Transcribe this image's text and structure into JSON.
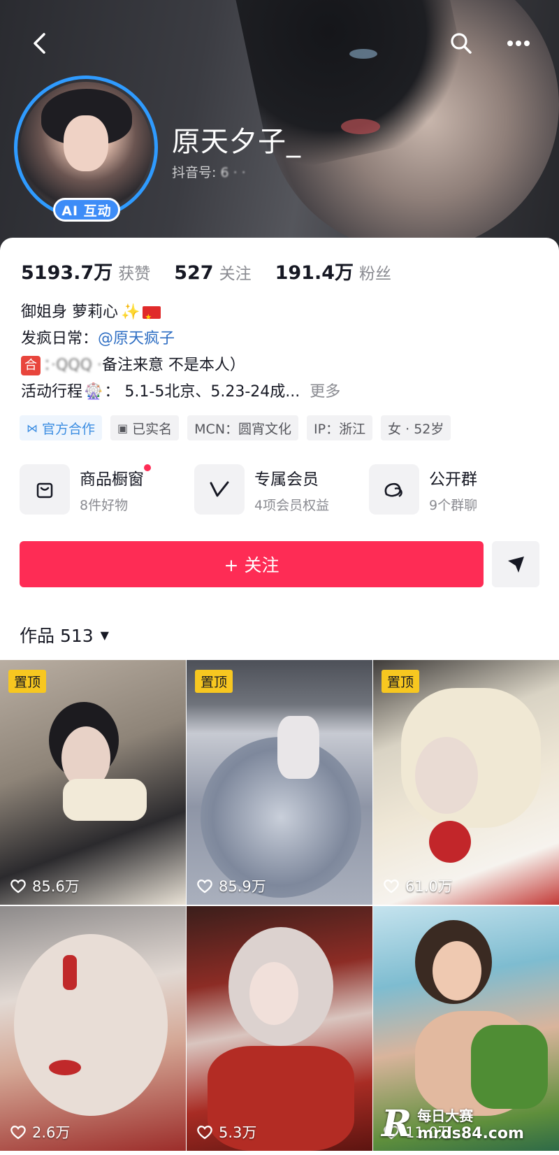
{
  "header": {
    "nickname": "原天夕子_",
    "douyin_id_label": "抖音号: ",
    "douyin_id_value": "6 · ·",
    "ai_badge": "AI 互动"
  },
  "stats": [
    {
      "value": "5193.7万",
      "label": "获赞"
    },
    {
      "value": "527",
      "label": "关注"
    },
    {
      "value": "191.4万",
      "label": "粉丝"
    }
  ],
  "bio": {
    "line1": "御姐身 萝莉心",
    "line2_prefix": "发疯日常：",
    "line2_link": "@原天疯子",
    "line3_icon": "合",
    "line3_blur": "：·QQQ  ·",
    "line3_text": "备注来意 不是本人）",
    "line4_prefix": "活动行程",
    "line4_text": "：  5.1-5北京、5.23-24成...",
    "more": "更多"
  },
  "tags": [
    {
      "label": "官方合作"
    },
    {
      "label": "已实名"
    },
    {
      "label": "MCN：圆宵文化"
    },
    {
      "label": "IP：浙江"
    },
    {
      "label": "女 · 52岁"
    }
  ],
  "services": [
    {
      "title": "商品橱窗",
      "sub": "8件好物"
    },
    {
      "title": "专属会员",
      "sub": "4项会员权益"
    },
    {
      "title": "公开群",
      "sub": "9个群聊"
    }
  ],
  "actions": {
    "follow": "+ 关注"
  },
  "works": {
    "label": "作品 513",
    "pin_label": "置顶",
    "items": [
      {
        "likes": "85.6万",
        "pinned": true
      },
      {
        "likes": "85.9万",
        "pinned": true
      },
      {
        "likes": "61.0万",
        "pinned": true
      },
      {
        "likes": "2.6万",
        "pinned": false
      },
      {
        "likes": "5.3万",
        "pinned": false
      },
      {
        "likes": "11.0万",
        "pinned": false
      }
    ]
  },
  "watermark": {
    "logo": "R",
    "line1": "每日大赛",
    "line2": "mrds84.com"
  },
  "colors": {
    "follow": "#fe2c55",
    "pin": "#f7c720",
    "link": "#2e6ec3",
    "avatar_ring": "#2f9bff"
  }
}
